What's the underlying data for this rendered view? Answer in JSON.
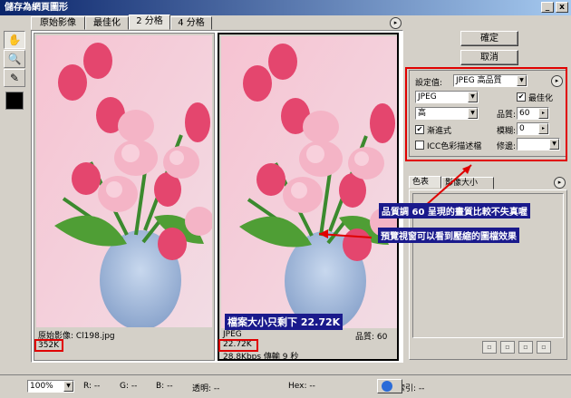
{
  "window": {
    "title": "儲存為網頁圖形",
    "min_label": "_",
    "close_label": "x"
  },
  "tabs": [
    "原始影像",
    "最佳化",
    "2 分格",
    "4 分格"
  ],
  "tab_menu_label": "▸",
  "tools": {
    "hand": "✋",
    "zoom": "🔍",
    "eyedropper": "✎"
  },
  "preview": {
    "left": {
      "label": "原始影像: Cl198.jpg",
      "size": "352K"
    },
    "right": {
      "format": "JPEG",
      "quality": "品質: 60",
      "size": "22.72K",
      "speed": "28.8Kbps 傳輸 9 秒"
    }
  },
  "buttons": {
    "ok": "確定",
    "cancel": "取消"
  },
  "settings": {
    "preset_label": "設定值:",
    "preset_value": "JPEG 高品質",
    "format": "JPEG",
    "optimized_label": "最佳化",
    "quality_level": "高",
    "quality_label": "品質:",
    "quality_value": "60",
    "progressive_label": "漸進式",
    "blur_label": "模糊:",
    "blur_value": "0",
    "icc_label": "ICC色彩描述檔",
    "matte_label": "修邊:",
    "matte_value": ""
  },
  "panel_tabs": [
    "色表",
    "影像大小"
  ],
  "status": {
    "zoom": "100%",
    "r": "R: --",
    "g": "G: --",
    "b": "B: --",
    "alpha": "透明: --",
    "hex": "Hex: --",
    "index": "索引: --"
  },
  "annotations": {
    "quality_note": "品質調 60 呈現的畫質比較不失真喔",
    "preview_note": "預覽視窗可以看到壓縮的圖檔效果",
    "size_note": "檔案大小只剩下 22.72K"
  },
  "colors": {
    "accent_red": "#e00000",
    "annotation_bg": "#1a1a8c",
    "title_blue": "#0a246a"
  }
}
